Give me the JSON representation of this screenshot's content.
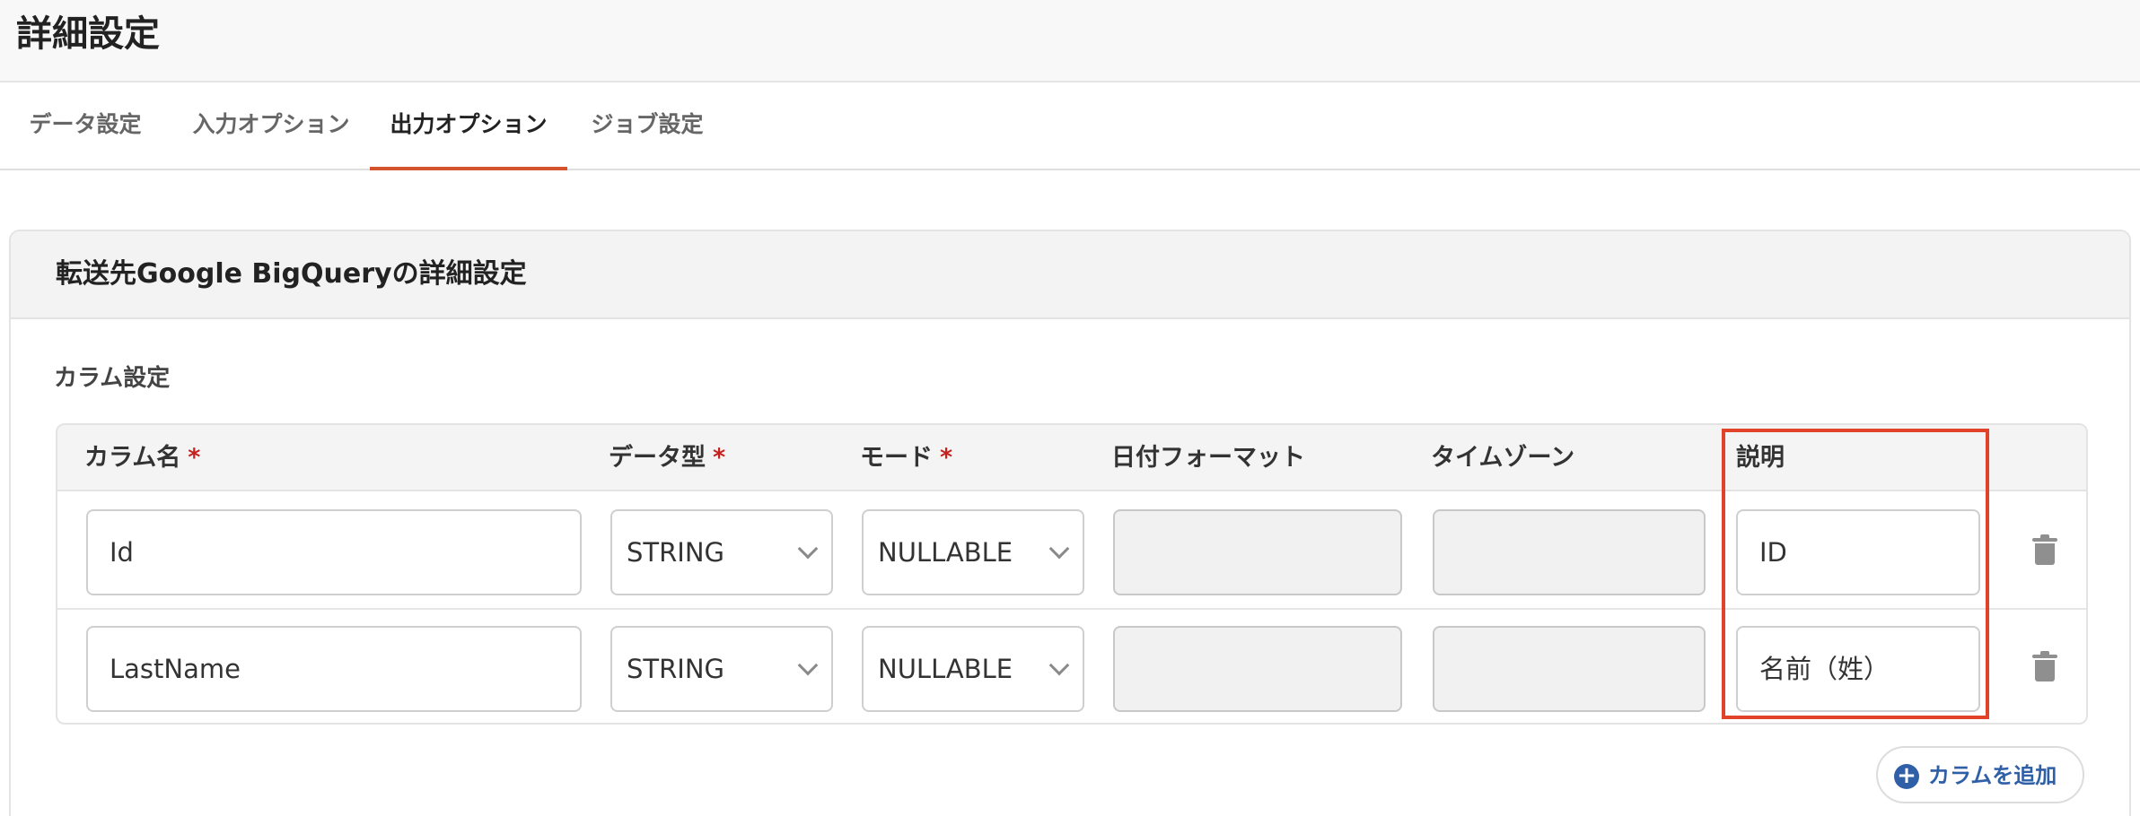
{
  "page": {
    "title": "詳細設定"
  },
  "tabs": [
    {
      "label": "データ設定"
    },
    {
      "label": "入力オプション"
    },
    {
      "label": "出力オプション"
    },
    {
      "label": "ジョブ設定"
    }
  ],
  "active_tab": "出力オプション",
  "panel": {
    "title": "転送先Google BigQueryの詳細設定"
  },
  "section": {
    "label": "カラム設定"
  },
  "columns": {
    "headers": {
      "name": "カラム名",
      "type": "データ型",
      "mode": "モード",
      "date_format": "日付フォーマット",
      "timezone": "タイムゾーン",
      "description": "説明"
    },
    "required_mark": "*",
    "rows": [
      {
        "name": "Id",
        "type": "STRING",
        "mode": "NULLABLE",
        "date_format": "",
        "timezone": "",
        "description": "ID"
      },
      {
        "name": "LastName",
        "type": "STRING",
        "mode": "NULLABLE",
        "date_format": "",
        "timezone": "",
        "description": "名前（姓）"
      }
    ]
  },
  "add_button": {
    "label": "カラムを追加",
    "icon": "plus-circle-icon"
  },
  "colors": {
    "accent": "#d4522c",
    "link": "#2f5fa7",
    "required": "#c5221f",
    "highlight": "#e0422a"
  }
}
